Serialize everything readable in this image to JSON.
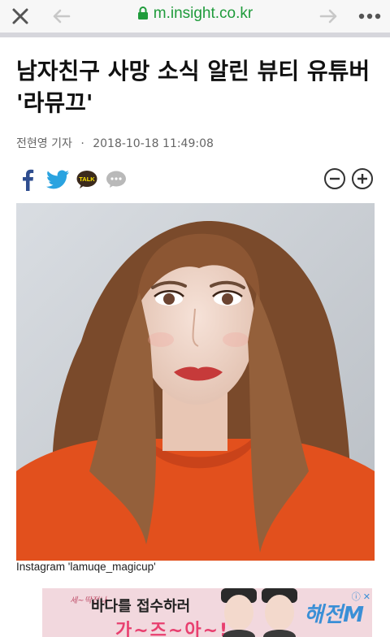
{
  "browser": {
    "url": "m.insight.co.kr",
    "close_icon": "close-icon",
    "back_icon": "arrow-left-icon",
    "forward_icon": "arrow-right-icon",
    "menu_icon": "more-dots-icon",
    "url_color": "#1f9b3b"
  },
  "article": {
    "title": "남자친구 사망 소식 알린 뷰티 유튜버 '라뮤끄'",
    "author": "전현영 기자",
    "separator": "·",
    "date": "2018-10-18 11:49:08",
    "share_icons": [
      "facebook-icon",
      "twitter-icon",
      "kakaotalk-icon",
      "comment-icon"
    ],
    "kakaotalk_label": "TALK",
    "zoom_icons": [
      "zoom-out-icon",
      "zoom-in-icon"
    ],
    "image_caption": "Instagram 'lamuqe_magicup'"
  },
  "ad": {
    "line1": "세~딱전나",
    "line2": "바다를 접수하러",
    "line3": "가~즈~아~!",
    "brand": "해전M",
    "adchoice": "ⓘ ✕"
  }
}
